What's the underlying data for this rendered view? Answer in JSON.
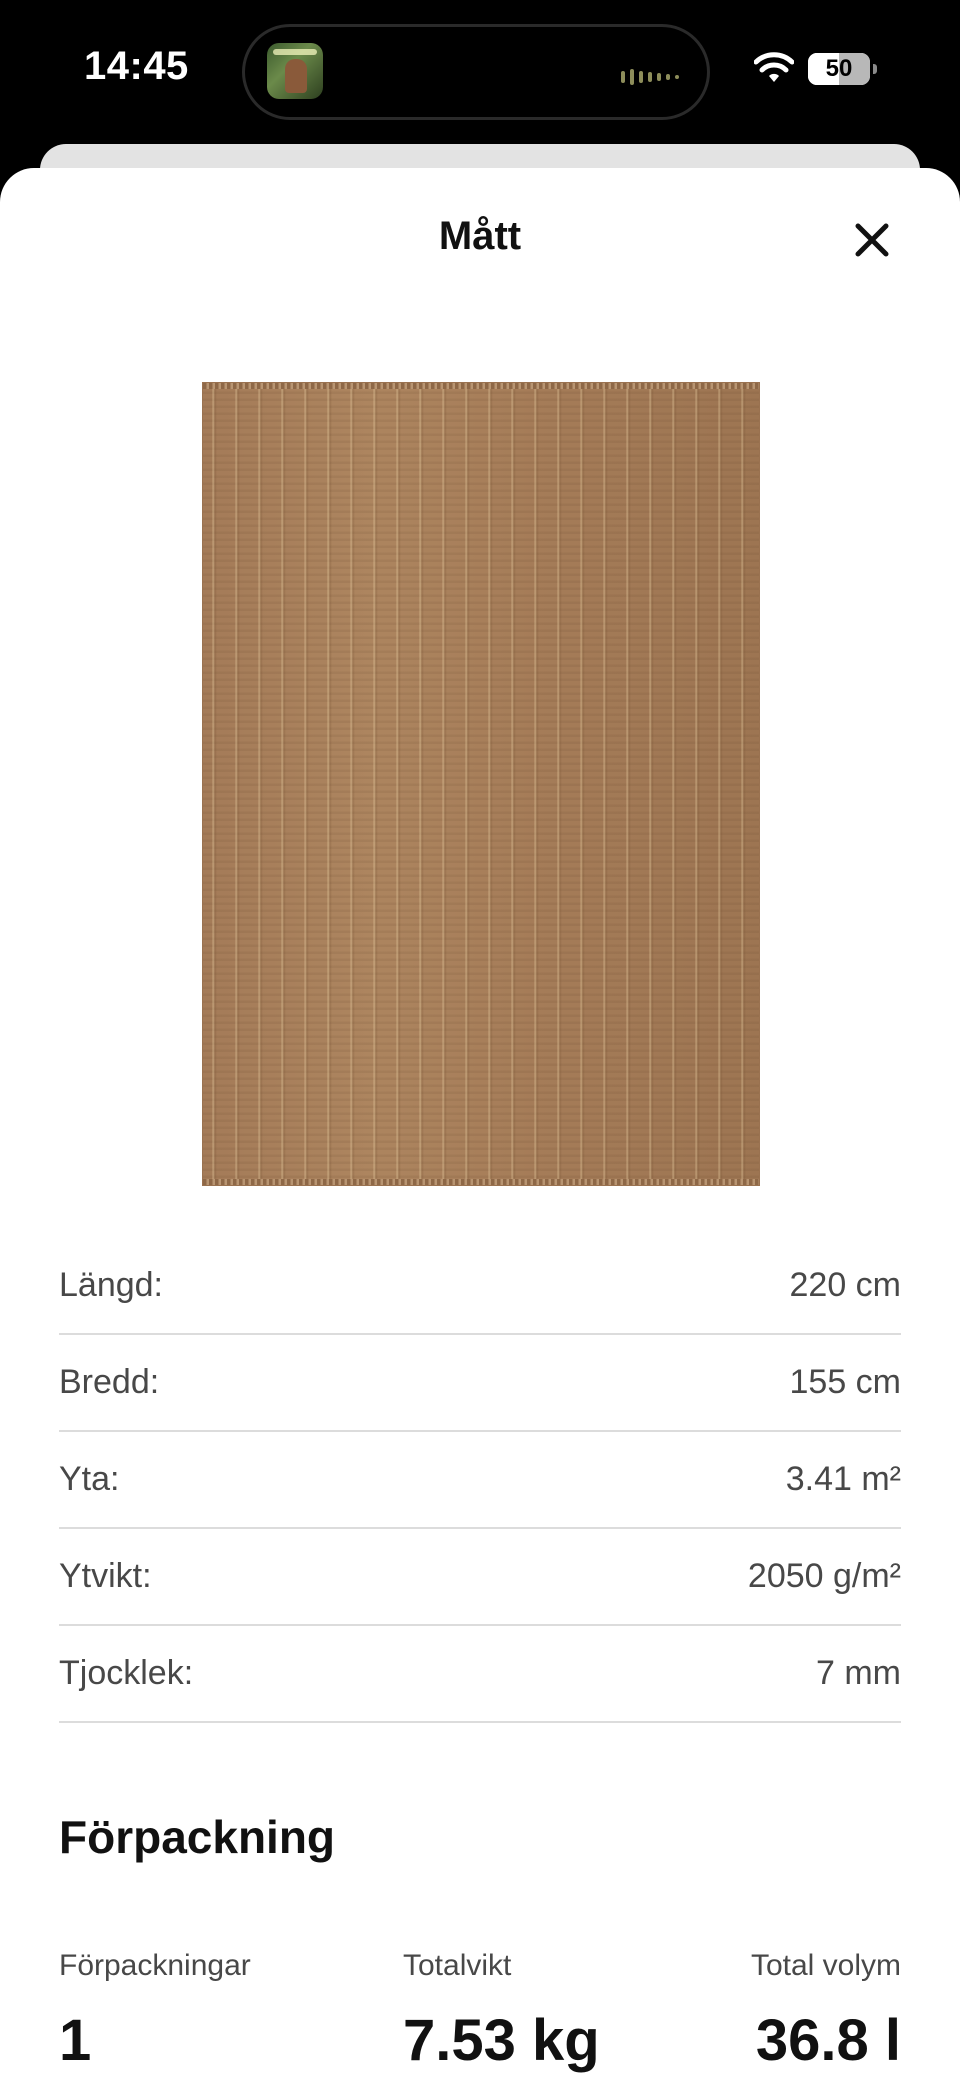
{
  "status_bar": {
    "time": "14:45",
    "battery_level": "50",
    "wifi_icon": "wifi-icon"
  },
  "sheet": {
    "title": "Mått",
    "close_icon": "close-icon"
  },
  "product_image": {
    "alt": "Jute rug"
  },
  "dimensions": [
    {
      "label": "Längd:",
      "value": "220 cm"
    },
    {
      "label": "Bredd:",
      "value": "155 cm"
    },
    {
      "label": "Yta:",
      "value": "3.41 m²"
    },
    {
      "label": "Ytvikt:",
      "value": "2050 g/m²"
    },
    {
      "label": "Tjocklek:",
      "value": "7 mm"
    }
  ],
  "packaging": {
    "heading": "Förpackning",
    "packages_label": "Förpackningar",
    "packages_value": "1",
    "weight_label": "Totalvikt",
    "weight_value": "7.53 kg",
    "volume_label": "Total volym",
    "volume_value": "36.8 l"
  }
}
